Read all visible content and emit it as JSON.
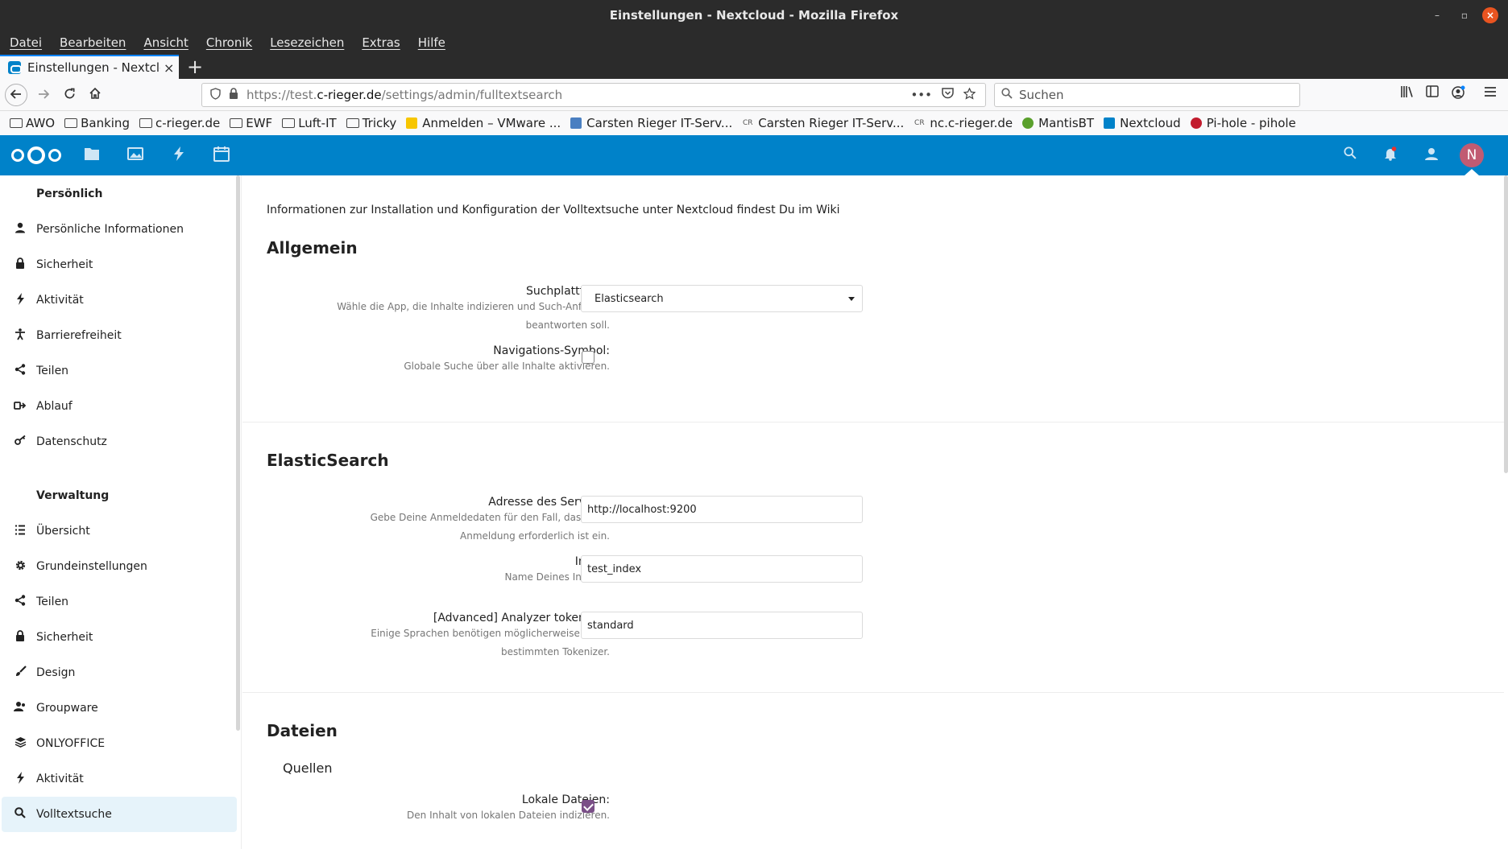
{
  "window": {
    "title": "Einstellungen - Nextcloud - Mozilla Firefox",
    "minimize": "–",
    "maximize": "▫",
    "close": "×"
  },
  "menu": [
    "Datei",
    "Bearbeiten",
    "Ansicht",
    "Chronik",
    "Lesezeichen",
    "Extras",
    "Hilfe"
  ],
  "tab": {
    "label": "Einstellungen - Nextcloud",
    "close": "×",
    "new_tab": "+"
  },
  "navbar": {
    "url_host_prefix": "https://test.",
    "url_host": "c-rieger.de",
    "url_path": "/settings/admin/fulltextsearch",
    "page_actions": "•••",
    "search_placeholder": "Suchen"
  },
  "bookmarks": [
    {
      "label": "AWO",
      "icon": "folder-icon"
    },
    {
      "label": "Banking",
      "icon": "folder-icon"
    },
    {
      "label": "c-rieger.de",
      "icon": "folder-icon"
    },
    {
      "label": "EWF",
      "icon": "folder-icon"
    },
    {
      "label": "Luft-IT",
      "icon": "folder-icon"
    },
    {
      "label": "Tricky",
      "icon": "folder-icon"
    },
    {
      "label": "Anmelden – VMware ...",
      "icon": "vmware-icon"
    },
    {
      "label": "Carsten Rieger IT-Serv...",
      "icon": "cube-icon"
    },
    {
      "label": "Carsten Rieger IT-Serv...",
      "icon": "cr-icon"
    },
    {
      "label": "nc.c-rieger.de",
      "icon": "cr-icon"
    },
    {
      "label": "MantisBT",
      "icon": "mantis-icon"
    },
    {
      "label": "Nextcloud",
      "icon": "nextcloud-icon"
    },
    {
      "label": "Pi-hole - pihole",
      "icon": "pihole-icon"
    }
  ],
  "nc_header": {
    "avatar_initial": "N"
  },
  "sidebar": {
    "personal_heading": "Persönlich",
    "personal_items": [
      {
        "label": "Persönliche Informationen",
        "icon": "user-icon"
      },
      {
        "label": "Sicherheit",
        "icon": "lock-icon"
      },
      {
        "label": "Aktivität",
        "icon": "bolt-icon"
      },
      {
        "label": "Barrierefreiheit",
        "icon": "accessibility-icon"
      },
      {
        "label": "Teilen",
        "icon": "share-icon"
      },
      {
        "label": "Ablauf",
        "icon": "flow-icon"
      },
      {
        "label": "Datenschutz",
        "icon": "key-icon"
      }
    ],
    "admin_heading": "Verwaltung",
    "admin_items": [
      {
        "label": "Übersicht",
        "icon": "list-icon"
      },
      {
        "label": "Grundeinstellungen",
        "icon": "gear-icon"
      },
      {
        "label": "Teilen",
        "icon": "share-icon"
      },
      {
        "label": "Sicherheit",
        "icon": "lock-icon"
      },
      {
        "label": "Design",
        "icon": "brush-icon"
      },
      {
        "label": "Groupware",
        "icon": "group-icon"
      },
      {
        "label": "ONLYOFFICE",
        "icon": "layers-icon"
      },
      {
        "label": "Aktivität",
        "icon": "bolt-icon"
      },
      {
        "label": "Volltextsuche",
        "icon": "search-icon",
        "active": true
      }
    ]
  },
  "main": {
    "intro": "Informationen zur Installation und Konfiguration der Volltextsuche unter Nextcloud findest Du im Wiki",
    "general": {
      "title": "Allgemein",
      "platform_label": "Suchplattform:",
      "platform_hint": "Wähle die App, die Inhalte indizieren und Such-Anfragen beantworten soll.",
      "platform_value": "Elasticsearch",
      "nav_label": "Navigations-Symbol:",
      "nav_hint": "Globale Suche über alle Inhalte aktivieren.",
      "nav_checked": false
    },
    "elastic": {
      "title": "ElasticSearch",
      "servlet_label": "Adresse des Servlets:",
      "servlet_hint": "Gebe Deine Anmeldedaten für den Fall, dass eine Anmeldung erforderlich ist ein.",
      "servlet_value": "http://localhost:9200",
      "index_label": "Index:",
      "index_hint": "Name Deines Indexes",
      "index_value": "test_index",
      "tokenizer_label": "[Advanced] Analyzer tokenizer:",
      "tokenizer_hint": "Einige Sprachen benötigen möglicherweise einen bestimmten Tokenizer.",
      "tokenizer_value": "standard"
    },
    "files": {
      "title": "Dateien",
      "sources_title": "Quellen",
      "local_label": "Lokale Dateien:",
      "local_hint": "Den Inhalt von lokalen Dateien indizieren.",
      "local_checked": true
    }
  },
  "colors": {
    "nextcloud_blue": "#0082c9",
    "checkbox_purple": "#7a4f87",
    "avatar": "#c15b72",
    "active_item": "#e6f3fa"
  }
}
